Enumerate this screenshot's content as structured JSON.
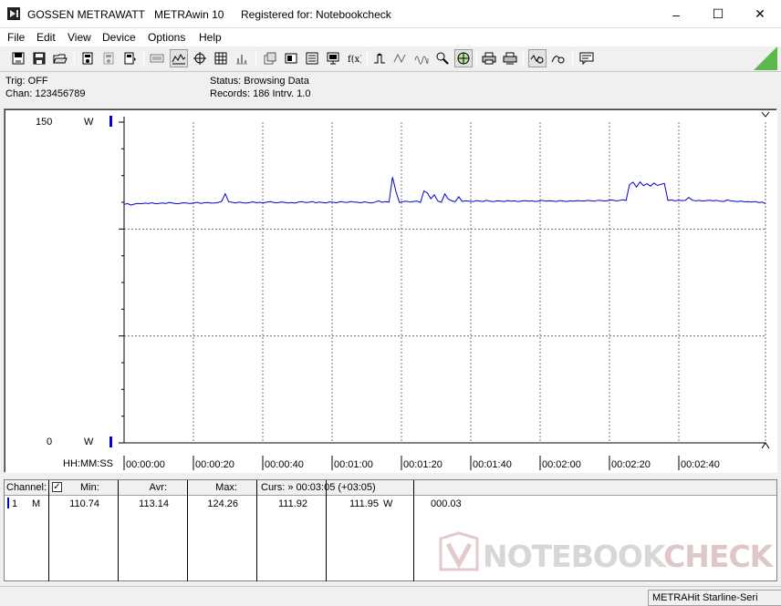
{
  "window": {
    "vendor": "GOSSEN METRAWATT",
    "app_name": "METRAwin 10",
    "registration": "Registered for: Notebookcheck",
    "controls": {
      "minimize": "–",
      "maximize": "☐",
      "close": "✕"
    }
  },
  "menu": [
    "File",
    "Edit",
    "View",
    "Device",
    "Options",
    "Help"
  ],
  "toolbar": {
    "buttons": [
      "open-file-icon",
      "save-icon",
      "folder-open-icon",
      "device-read-icon",
      "device-grey-icon",
      "device-send-icon",
      "keyboard-icon",
      "wave-view-icon",
      "crosshair-icon",
      "table-icon",
      "histogram-icon",
      "copy-icon",
      "export-icon",
      "print-list-icon",
      "monitor-icon",
      "function-icon",
      "trigger-up-icon",
      "trigger-wave-icon",
      "search-icon",
      "globe-icon",
      "print-icon",
      "print-preview-icon",
      "zoom-wave-icon",
      "zoom-curve-icon",
      "comment-icon"
    ]
  },
  "status": {
    "trig": "Trig: OFF",
    "chan": "Chan:  123456789",
    "status": "Status:    Browsing Data",
    "records": "Records: 186  Intrv. 1.0"
  },
  "plot": {
    "y_max_label": "150",
    "y_min_label": "0",
    "y_unit": "W",
    "x_axis_format": "HH:MM:SS",
    "line_color": "#0000d0"
  },
  "chart_data": {
    "type": "line",
    "title": "",
    "xlabel": "HH:MM:SS",
    "ylabel": "W",
    "ylim": [
      0,
      150
    ],
    "xlim": [
      0,
      185
    ],
    "grid": true,
    "x_tick_labels": [
      "00:00:00",
      "00:00:20",
      "00:00:40",
      "00:01:00",
      "00:01:20",
      "00:01:40",
      "00:02:00",
      "00:02:20",
      "00:02:40"
    ],
    "x_tick_seconds": [
      0,
      20,
      40,
      60,
      80,
      100,
      120,
      140,
      160
    ],
    "series": [
      {
        "values": [
          111.5,
          111.9,
          111.2,
          111.7,
          112.0,
          111.8,
          112.1,
          111.9,
          112.3,
          111.8,
          112.0,
          112.2,
          111.9,
          112.4,
          112.1,
          111.8,
          112.0,
          112.3,
          112.1,
          111.9,
          112.2,
          112.5,
          112.0,
          112.3,
          112.4,
          112.1,
          112.2,
          112.4,
          113.0,
          116.5,
          112.8,
          112.5,
          112.2,
          112.6,
          112.3,
          112.1,
          112.4,
          112.7,
          112.3,
          112.5,
          112.2,
          112.6,
          112.8,
          112.4,
          112.3,
          112.6,
          112.5,
          112.2,
          112.4,
          112.1,
          112.6,
          112.8,
          112.4,
          112.5,
          112.9,
          112.3,
          112.6,
          112.4,
          112.2,
          112.7,
          112.5,
          112.3,
          112.8,
          112.6,
          112.4,
          112.9,
          112.6,
          112.5,
          112.3,
          112.7,
          112.4,
          112.2,
          112.6,
          113.2,
          112.5,
          112.8,
          112.6,
          124.26,
          117.5,
          112.4,
          112.8,
          113.0,
          112.6,
          112.9,
          113.1,
          112.4,
          117.8,
          116.9,
          114.2,
          116.0,
          113.1,
          112.5,
          116.4,
          114.0,
          113.2,
          112.8,
          115.1,
          112.9,
          113.2,
          113.0,
          112.8,
          113.3,
          113.1,
          112.9,
          113.4,
          113.0,
          112.8,
          113.2,
          113.1,
          112.9,
          113.3,
          113.0,
          113.2,
          112.8,
          113.1,
          113.3,
          113.0,
          113.2,
          112.9,
          113.1,
          113.4,
          113.0,
          113.2,
          113.1,
          112.9,
          113.3,
          113.1,
          112.9,
          113.2,
          113.0,
          113.3,
          113.2,
          113.1,
          113.4,
          113.2,
          113.0,
          113.5,
          113.3,
          113.1,
          113.4,
          113.6,
          113.2,
          113.3,
          113.7,
          113.4,
          120.8,
          121.9,
          119.6,
          122.0,
          120.3,
          121.2,
          120.1,
          121.5,
          120.4,
          120.9,
          121.3,
          113.4,
          113.6,
          113.2,
          113.5,
          113.3,
          113.4,
          114.8,
          113.5,
          113.2,
          113.4,
          113.1,
          113.3,
          113.5,
          113.2,
          113.4,
          113.0,
          112.9,
          113.6,
          113.2,
          113.0,
          112.8,
          113.1,
          112.7,
          112.8,
          112.6,
          112.9,
          112.4,
          112.6,
          111.92
        ]
      }
    ]
  },
  "table": {
    "headers": {
      "channel": "Channel:",
      "min": "Min:",
      "avr": "Avr:",
      "max": "Max:",
      "curs": "Curs: » 00:03:05 (+03:05)"
    },
    "row": {
      "channel_num": "1",
      "channel_mode": "M",
      "min": "110.74",
      "avr": "113.14",
      "max": "124.26",
      "curs1": "111.92",
      "curs2": "111.95",
      "unit": "W",
      "extra": "000.03"
    }
  },
  "statusbar": {
    "device": "METRAHit Starline-Seri"
  },
  "watermark": {
    "part1": "NOTEBOOK",
    "part2": "CHECK"
  }
}
